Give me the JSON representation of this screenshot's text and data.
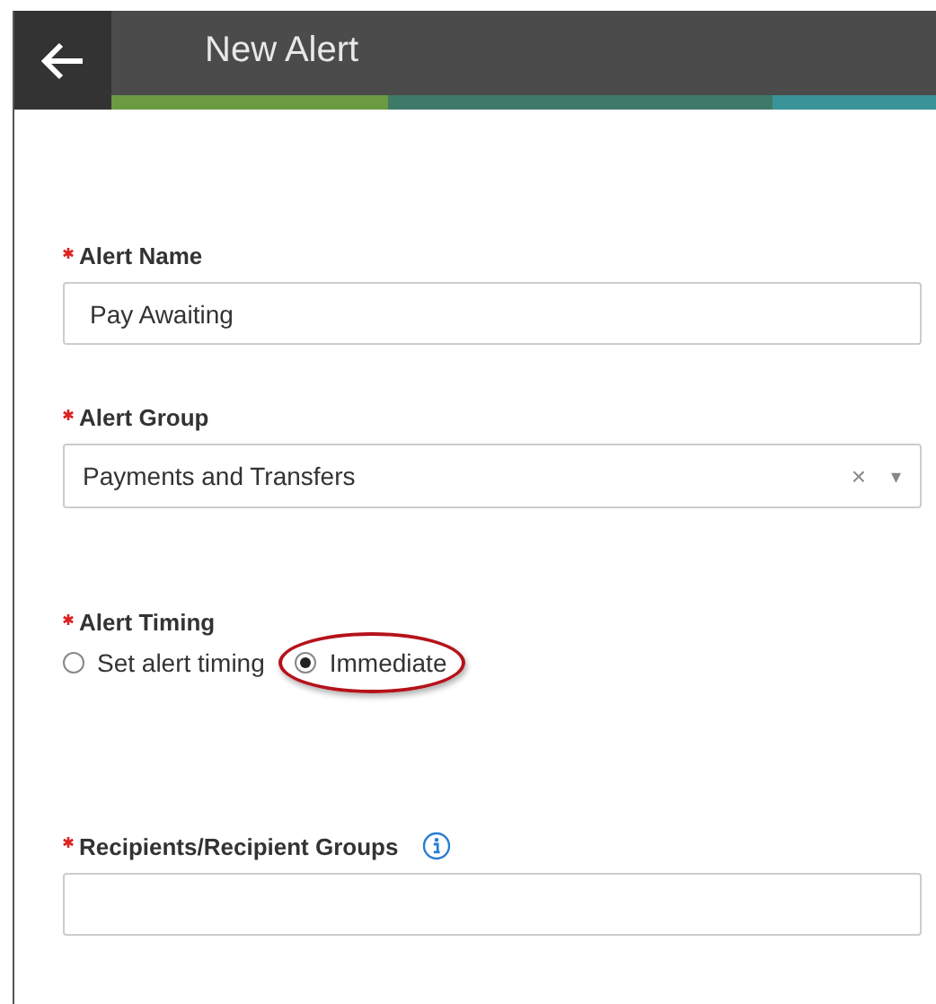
{
  "header": {
    "title": "New Alert"
  },
  "fields": [
    {
      "kind": "text",
      "label": "Alert Name",
      "required": true,
      "value": "Pay Awaiting"
    },
    {
      "kind": "select",
      "label": "Alert Group",
      "required": true,
      "value": "Payments and Transfers",
      "clear": "×",
      "caret": "▾"
    },
    {
      "kind": "radio",
      "label": "Alert Timing",
      "required": true,
      "options": [
        {
          "label": "Set alert timing",
          "selected": false,
          "highlighted": false
        },
        {
          "label": "Immediate",
          "selected": true,
          "highlighted": true
        }
      ]
    },
    {
      "kind": "text",
      "label": "Recipients/Recipient Groups",
      "required": true,
      "info": true
    }
  ]
}
